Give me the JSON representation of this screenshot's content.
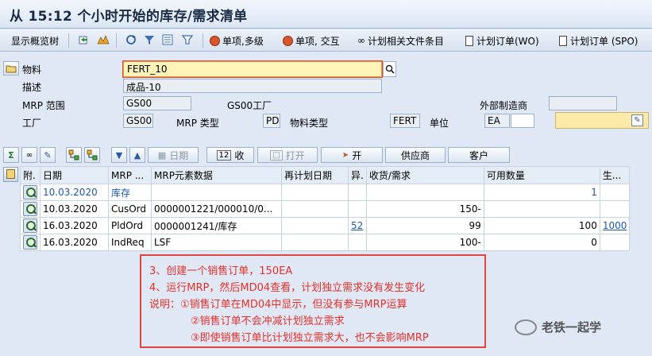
{
  "title": "从 15:12 个小时开始的库存/需求清单",
  "toolbar": {
    "display_overview_tree": "显示概览树",
    "single_item_multilevel": "单项,多级",
    "single_item_interactive": "单项, 交互",
    "planning_file_entry": "计划相关文件条目",
    "planned_order_wo": "计划订单(WO)",
    "planned_order_spo": "计划订单 (SPO)"
  },
  "header": {
    "material_label": "物料",
    "material_value": "FERT_10",
    "description_label": "描述",
    "description_value": "成品-10",
    "mrp_area_label": "MRP 范围",
    "mrp_area_value": "GS00",
    "mrp_area_desc": "GS00工厂",
    "external_proc_label": "外部制造商",
    "plant_label": "工厂",
    "plant_value": "GS00",
    "mrp_type_label": "MRP 类型",
    "mrp_type_value": "PD",
    "material_type_label": "物料类型",
    "material_type_value": "FERT",
    "unit_label": "单位",
    "unit_value": "EA"
  },
  "buttons": {
    "date": "日期",
    "receipts": "收",
    "open": "打开",
    "on": "开",
    "vendor": "供应商",
    "customer": "客户"
  },
  "table": {
    "columns": [
      "附.",
      "日期",
      "MRP ...",
      "MRP元素数据",
      "再计划日期",
      "异.",
      "收货/需求",
      "可用数量",
      "生..."
    ],
    "rows": [
      {
        "date": "10.03.2020",
        "mrp": "库存",
        "data": "",
        "resched": "",
        "exc": "",
        "qty": "",
        "avail": "1",
        "prod": ""
      },
      {
        "date": "10.03.2020",
        "mrp": "CusOrd",
        "data": "0000001221/000010/0...",
        "resched": "",
        "exc": "",
        "qty": "150-",
        "avail": "",
        "prod": ""
      },
      {
        "date": "16.03.2020",
        "mrp": "PldOrd",
        "data": "0000001241/库存",
        "resched": "",
        "exc": "52",
        "qty": "99",
        "avail": "100",
        "prod": "1000"
      },
      {
        "date": "16.03.2020",
        "mrp": "IndReq",
        "data": "LSF",
        "resched": "",
        "exc": "",
        "qty": "100-",
        "avail": "0",
        "prod": ""
      }
    ]
  },
  "annotation": {
    "line1": "3、创建一个销售订单，150EA",
    "line2": "4、运行MRP，然后MD04查看，计划独立需求没有发生变化",
    "line3": "说明：①销售订单在MD04中显示，但没有参与MRP运算",
    "line4": "②销售订单不会冲减计划独立需求",
    "line5": "③即使销售订单比计划独立需求大，也不会影响MRP"
  },
  "watermark": "老铁一起学",
  "colors": {
    "annotation": "#e5312a",
    "highlight_field": "#fff4b8",
    "link": "#1b56b0"
  }
}
